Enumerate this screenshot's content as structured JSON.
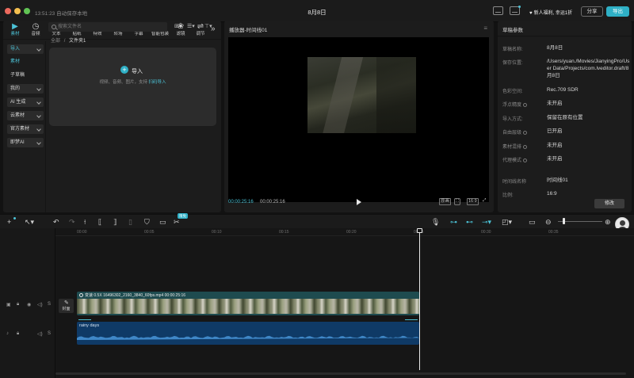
{
  "titlebar": {
    "save_status": "13:51:23 自动保存本地",
    "project_title": "8月8日",
    "welfare_label": "新人福利, 幸运1折",
    "share_label": "分享",
    "export_label": "导出"
  },
  "media": {
    "tabs": [
      {
        "label": "素材",
        "icon": "media-icon",
        "glyph": "▶"
      },
      {
        "label": "音频",
        "icon": "audio-icon",
        "glyph": "◷"
      },
      {
        "label": "文本",
        "icon": "text-icon",
        "glyph": "TI"
      },
      {
        "label": "贴纸",
        "icon": "sticker-icon",
        "glyph": "◉"
      },
      {
        "label": "特效",
        "icon": "effects-icon",
        "glyph": "✦"
      },
      {
        "label": "转场",
        "icon": "transition-icon",
        "glyph": "⋈"
      },
      {
        "label": "字幕",
        "icon": "subtitle-icon",
        "glyph": "▤"
      },
      {
        "label": "智能包装",
        "icon": "smart-package-icon",
        "glyph": "⇪"
      },
      {
        "label": "滤镜",
        "icon": "filter-icon",
        "glyph": "❀"
      },
      {
        "label": "调节",
        "icon": "adjust-icon",
        "glyph": "⇌"
      }
    ],
    "side_items": [
      {
        "label": "导入",
        "pill": true,
        "active": true
      },
      {
        "label": "素材",
        "pill": false,
        "active": true
      },
      {
        "label": "子草稿",
        "pill": false,
        "active": false
      },
      {
        "label": "我的",
        "pill": true,
        "active": false
      },
      {
        "label": "AI 生成",
        "pill": true,
        "active": false
      },
      {
        "label": "云素材",
        "pill": true,
        "active": false
      },
      {
        "label": "官方素材",
        "pill": true,
        "active": false
      },
      {
        "label": "即梦AI",
        "pill": true,
        "active": false
      }
    ],
    "search_placeholder": "搜索文件名",
    "breadcrumb_root": "全部",
    "breadcrumb_sep": "/",
    "breadcrumb_current": "文件夹1",
    "import_title": "导入",
    "import_hint": "视频、音频、图片，支持",
    "import_hint_link": "扫码导入"
  },
  "player": {
    "title": "播放器-时间线01",
    "time_current": "00:00:25:16",
    "time_total": "00:00:25:16",
    "btn_original": "原画",
    "btn_ratio": "16:9"
  },
  "params": {
    "title": "草稿参数",
    "rows": [
      {
        "label": "草稿名称:",
        "value": "8月8日",
        "info": false
      },
      {
        "label": "保存位置:",
        "value": "/Users/yuan./Movies/JianyingPro/User Data/Projects/com.lveditor.draft/8月8日",
        "info": false
      },
      {
        "label": "色彩空间:",
        "value": "Rec.709 SDR",
        "info": false
      },
      {
        "label": "浮点精度",
        "value": "未开启",
        "info": true
      },
      {
        "label": "导入方式:",
        "value": "保留在原有位置",
        "info": false
      },
      {
        "label": "自由层级",
        "value": "已开启",
        "info": true
      },
      {
        "label": "素材混排",
        "value": "未开启",
        "info": true
      },
      {
        "label": "代理模式",
        "value": "未开启",
        "info": true
      },
      {
        "label": "时间线名称",
        "value": "时间线01",
        "info": false
      },
      {
        "label": "比例:",
        "value": "16:9",
        "info": false
      }
    ],
    "modify_label": "修改"
  },
  "timeline": {
    "free_badge": "限免",
    "ruler_ticks": [
      "00:00",
      "00:05",
      "00:10",
      "00:15",
      "00:20",
      "00:25",
      "00:30",
      "00:35"
    ],
    "cover_label": "封面",
    "video_clip_label": "变速 0.5X  16496302_2160_3840_60fps.mp4  00:00:25:16",
    "audio_clip_label": "rainy days"
  },
  "colors": {
    "accent": "#2fb0c6",
    "accent_text": "#4cc3d7",
    "video_clip": "#1e4b4f",
    "audio_clip": "#0f3a66",
    "panel": "#1c1c1c",
    "background": "#121212"
  }
}
